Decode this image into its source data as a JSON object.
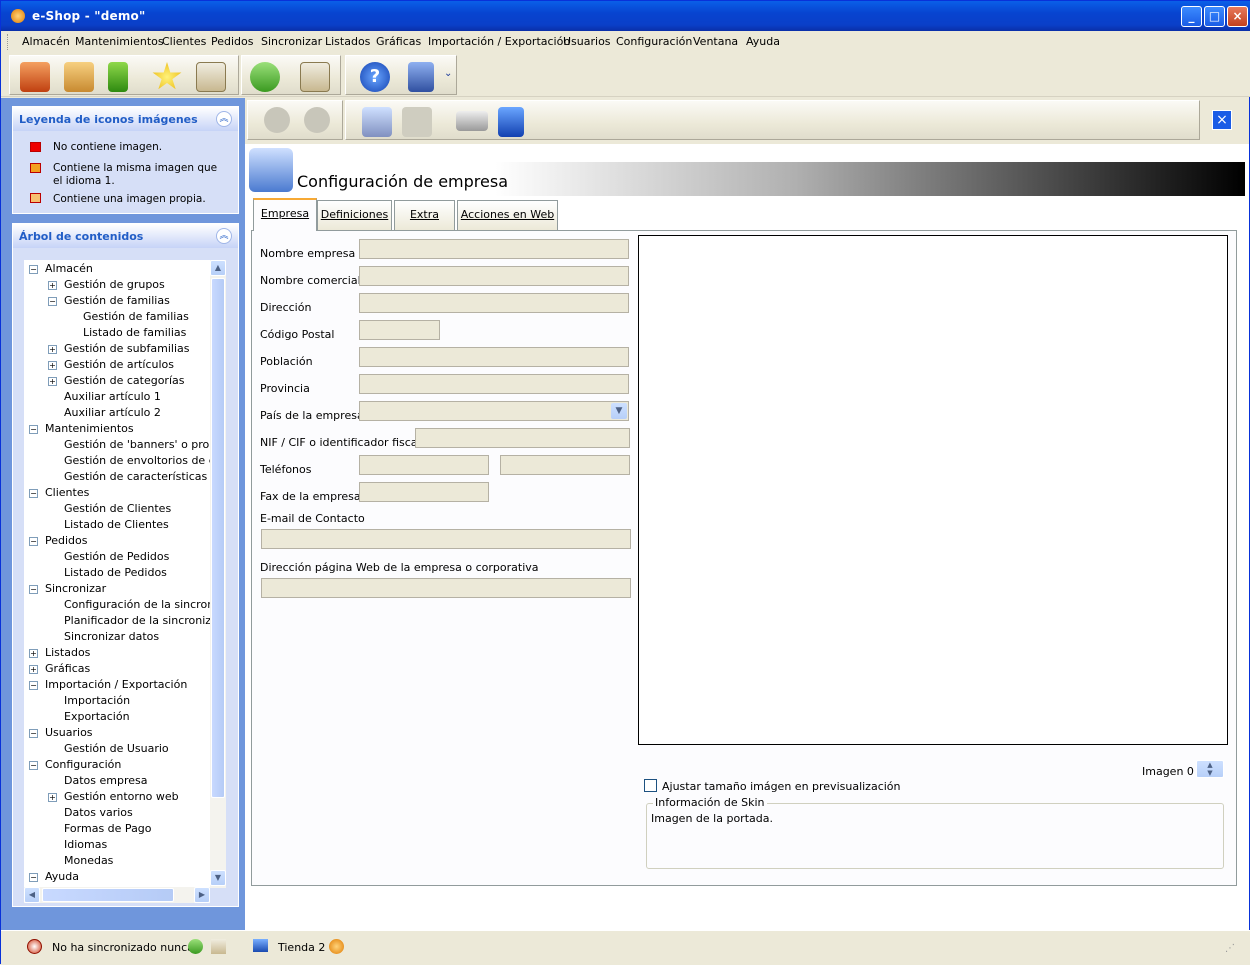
{
  "window": {
    "title": "e-Shop - \"demo\""
  },
  "menu": [
    "Almacén",
    "Mantenimientos",
    "Clientes",
    "Pedidos",
    "Sincronizar",
    "Listados",
    "Gráficas",
    "Importación / Exportación",
    "Usuarios",
    "Configuración",
    "Ventana",
    "Ayuda"
  ],
  "legend": {
    "title": "Leyenda de iconos imágenes",
    "items": [
      "No contiene imagen.",
      "Contiene la misma imagen que el idioma 1.",
      "Contiene una imagen propia."
    ]
  },
  "tree": {
    "title": "Árbol de contenidos",
    "nodes": [
      {
        "label": "Almacén",
        "level": 0,
        "exp": "-"
      },
      {
        "label": "Gestión de grupos",
        "level": 1,
        "exp": "+"
      },
      {
        "label": "Gestión de familias",
        "level": 1,
        "exp": "-"
      },
      {
        "label": "Gestión de familias",
        "level": 2,
        "exp": ""
      },
      {
        "label": "Listado de familias",
        "level": 2,
        "exp": ""
      },
      {
        "label": "Gestión de subfamilias",
        "level": 1,
        "exp": "+"
      },
      {
        "label": "Gestión de artículos",
        "level": 1,
        "exp": "+"
      },
      {
        "label": "Gestión de categorías",
        "level": 1,
        "exp": "+"
      },
      {
        "label": "Auxiliar artículo 1",
        "level": 1,
        "exp": ""
      },
      {
        "label": "Auxiliar artículo 2",
        "level": 1,
        "exp": ""
      },
      {
        "label": "Mantenimientos",
        "level": 0,
        "exp": "-"
      },
      {
        "label": "Gestión de 'banners' o promoci",
        "level": 1,
        "exp": ""
      },
      {
        "label": "Gestión de envoltorios de e",
        "level": 1,
        "exp": ""
      },
      {
        "label": "Gestión de características",
        "level": 1,
        "exp": ""
      },
      {
        "label": "Clientes",
        "level": 0,
        "exp": "-"
      },
      {
        "label": "Gestión de Clientes",
        "level": 1,
        "exp": ""
      },
      {
        "label": "Listado de Clientes",
        "level": 1,
        "exp": ""
      },
      {
        "label": "Pedidos",
        "level": 0,
        "exp": "-"
      },
      {
        "label": "Gestión de Pedidos",
        "level": 1,
        "exp": ""
      },
      {
        "label": "Listado de Pedidos",
        "level": 1,
        "exp": ""
      },
      {
        "label": "Sincronizar",
        "level": 0,
        "exp": "-"
      },
      {
        "label": "Configuración de la sincronizac",
        "level": 1,
        "exp": ""
      },
      {
        "label": "Planificador de la sincronizació",
        "level": 1,
        "exp": ""
      },
      {
        "label": "Sincronizar datos",
        "level": 1,
        "exp": ""
      },
      {
        "label": "Listados",
        "level": 0,
        "exp": "+"
      },
      {
        "label": "Gráficas",
        "level": 0,
        "exp": "+"
      },
      {
        "label": "Importación / Exportación",
        "level": 0,
        "exp": "-"
      },
      {
        "label": "Importación",
        "level": 1,
        "exp": ""
      },
      {
        "label": "Exportación",
        "level": 1,
        "exp": ""
      },
      {
        "label": "Usuarios",
        "level": 0,
        "exp": "-"
      },
      {
        "label": "Gestión de Usuario",
        "level": 1,
        "exp": ""
      },
      {
        "label": "Configuración",
        "level": 0,
        "exp": "-"
      },
      {
        "label": "Datos empresa",
        "level": 1,
        "exp": ""
      },
      {
        "label": "Gestión entorno web",
        "level": 1,
        "exp": "+"
      },
      {
        "label": "Datos varios",
        "level": 1,
        "exp": ""
      },
      {
        "label": "Formas de Pago",
        "level": 1,
        "exp": ""
      },
      {
        "label": "Idiomas",
        "level": 1,
        "exp": ""
      },
      {
        "label": "Monedas",
        "level": 1,
        "exp": ""
      },
      {
        "label": "Ayuda",
        "level": 0,
        "exp": "-"
      }
    ]
  },
  "form": {
    "header": "Configuración de empresa",
    "tabs": [
      "Empresa",
      "Definiciones",
      "Extra",
      "Acciones en Web"
    ],
    "labels": {
      "nombre": "Nombre empresa",
      "comercial": "Nombre comercial",
      "direccion": "Dirección",
      "cp": "Código Postal",
      "poblacion": "Población",
      "provincia": "Provincia",
      "pais": "País de la empresa",
      "nif": "NIF / CIF o identificador fiscal",
      "telefonos": "Teléfonos",
      "fax": "Fax de la empresa",
      "email": "E-mail de Contacto",
      "web": "Dirección página Web de la empresa o corporativa"
    },
    "imagen_label": "Imagen 0",
    "ajustar": "Ajustar tamaño imágen en previsualización",
    "skin_title": "Información de Skin",
    "skin_text": "Imagen de la portada."
  },
  "status": {
    "sync": "No ha sincronizado nunca.",
    "store": "Tienda 2"
  }
}
